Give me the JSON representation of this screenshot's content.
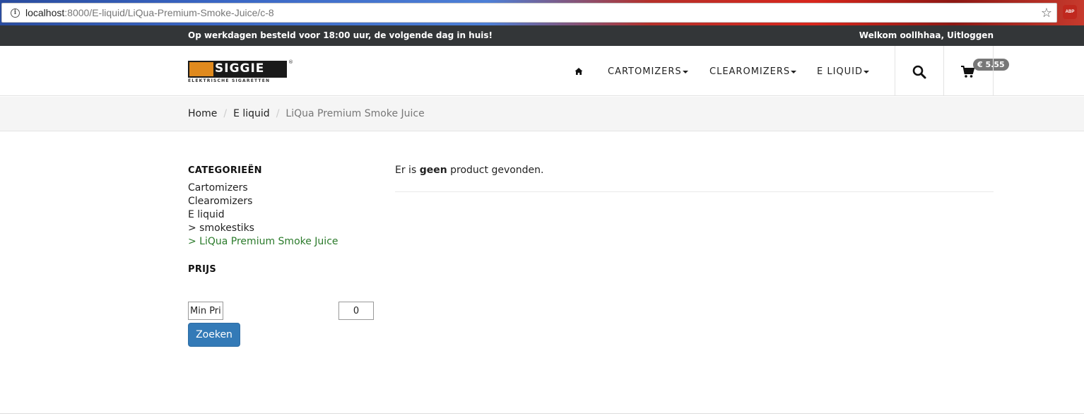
{
  "browser": {
    "url_host": "localhost",
    "url_rest": ":8000/E-liquid/LiQua-Premium-Smoke-Juice/c-8",
    "extension_label": "ABP"
  },
  "topbar": {
    "notice": "Op werkdagen besteld voor 18:00 uur, de volgende dag in huis!",
    "welcome": "Welkom oollhhaa, Uitloggen"
  },
  "logo": {
    "word": "SIGGIE",
    "tagline": "ELEKTRISCHE SIGARETTEN",
    "reg": "®"
  },
  "nav": {
    "items": [
      {
        "label": "CARTOMIZERS"
      },
      {
        "label": "CLEAROMIZERS"
      },
      {
        "label": "E LIQUID"
      }
    ],
    "cart_total": "€ 5.55"
  },
  "breadcrumb": {
    "items": [
      "Home",
      "E liquid"
    ],
    "current": "LiQua Premium Smoke Juice",
    "separator": "/"
  },
  "sidebar": {
    "categories_title": "CATEGORIEËN",
    "categories": [
      {
        "label": "Cartomizers",
        "active": false
      },
      {
        "label": "Clearomizers",
        "active": false
      },
      {
        "label": "E liquid",
        "active": false
      },
      {
        "label": "> smokestiks",
        "active": false
      },
      {
        "label": "> LiQua Premium Smoke Juice",
        "active": true
      }
    ],
    "price_title": "PRIJS",
    "min_price_value": "Min Pri",
    "max_price_value": "0",
    "search_button": "Zoeken"
  },
  "main": {
    "msg_prefix": "Er is",
    "msg_bold": "geen",
    "msg_suffix": "product gevonden."
  },
  "colors": {
    "topbar_bg": "#333638",
    "active_category": "#2a7a2a",
    "button_primary": "#337ab7",
    "badge_bg": "#777777"
  }
}
